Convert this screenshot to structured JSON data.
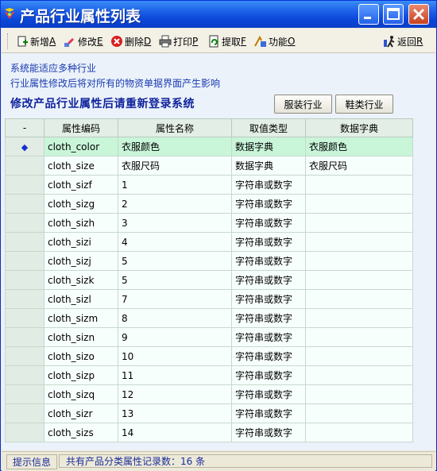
{
  "window": {
    "title": "产品行业属性列表"
  },
  "toolbar": {
    "add": {
      "text": "新增",
      "key": "A"
    },
    "edit": {
      "text": "修改",
      "key": "E"
    },
    "delete": {
      "text": "删除",
      "key": "D"
    },
    "print": {
      "text": "打印",
      "key": "P"
    },
    "fetch": {
      "text": "提取",
      "key": "F"
    },
    "function": {
      "text": "功能",
      "key": "O"
    },
    "back": {
      "text": "返回",
      "key": "R"
    }
  },
  "info": {
    "line1": "系统能适应多种行业",
    "line2": "行业属性修改后将对所有的物资单据界面产生影响",
    "warning": "修改产品行业属性后请重新登录系统"
  },
  "buttons": {
    "clothing": "服装行业",
    "shoes": "鞋类行业"
  },
  "grid": {
    "columns": [
      "-",
      "属性编码",
      "属性名称",
      "取值类型",
      "数据字典"
    ],
    "rows": [
      {
        "code": "cloth_color",
        "name": "衣服颜色",
        "type": "数据字典",
        "dict": "衣服颜色"
      },
      {
        "code": "cloth_size",
        "name": "衣服尺码",
        "type": "数据字典",
        "dict": "衣服尺码"
      },
      {
        "code": "cloth_sizf",
        "name": "1",
        "type": "字符串或数字",
        "dict": ""
      },
      {
        "code": "cloth_sizg",
        "name": "2",
        "type": "字符串或数字",
        "dict": ""
      },
      {
        "code": "cloth_sizh",
        "name": "3",
        "type": "字符串或数字",
        "dict": ""
      },
      {
        "code": "cloth_sizi",
        "name": "4",
        "type": "字符串或数字",
        "dict": ""
      },
      {
        "code": "cloth_sizj",
        "name": "5",
        "type": "字符串或数字",
        "dict": ""
      },
      {
        "code": "cloth_sizk",
        "name": "5",
        "type": "字符串或数字",
        "dict": ""
      },
      {
        "code": "cloth_sizl",
        "name": "7",
        "type": "字符串或数字",
        "dict": ""
      },
      {
        "code": "cloth_sizm",
        "name": "8",
        "type": "字符串或数字",
        "dict": ""
      },
      {
        "code": "cloth_sizn",
        "name": "9",
        "type": "字符串或数字",
        "dict": ""
      },
      {
        "code": "cloth_sizo",
        "name": "10",
        "type": "字符串或数字",
        "dict": ""
      },
      {
        "code": "cloth_sizp",
        "name": "11",
        "type": "字符串或数字",
        "dict": ""
      },
      {
        "code": "cloth_sizq",
        "name": "12",
        "type": "字符串或数字",
        "dict": ""
      },
      {
        "code": "cloth_sizr",
        "name": "13",
        "type": "字符串或数字",
        "dict": ""
      },
      {
        "code": "cloth_sizs",
        "name": "14",
        "type": "字符串或数字",
        "dict": ""
      }
    ]
  },
  "status": {
    "hint": "提示信息",
    "message": "共有产品分类属性记录数：16 条"
  }
}
